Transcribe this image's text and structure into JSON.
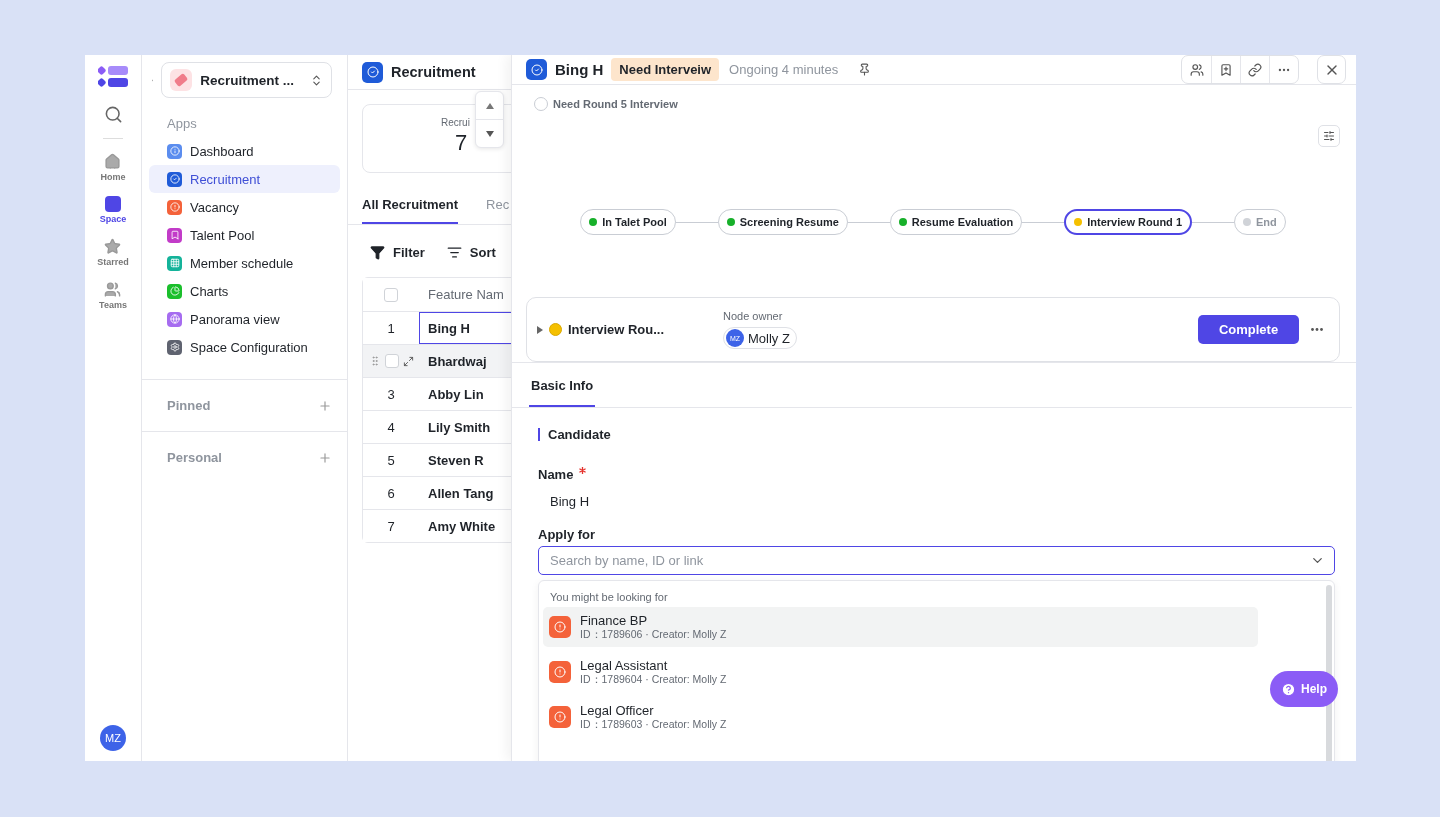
{
  "rail": {
    "items": [
      {
        "label": "Home",
        "selected": false
      },
      {
        "label": "Space",
        "selected": true
      },
      {
        "label": "Starred",
        "selected": false
      },
      {
        "label": "Teams",
        "selected": false
      }
    ],
    "avatar": "MZ"
  },
  "sidebar": {
    "space": "Recruitment ...",
    "section": "Apps",
    "items": [
      {
        "label": "Dashboard",
        "color": "#5b8def",
        "selected": false
      },
      {
        "label": "Recruitment",
        "color": "#1f5bd8",
        "selected": true
      },
      {
        "label": "Vacancy",
        "color": "#f4623a",
        "selected": false
      },
      {
        "label": "Talent Pool",
        "color": "#c23bc8",
        "selected": false
      },
      {
        "label": "Member schedule",
        "color": "#14b39a",
        "selected": false
      },
      {
        "label": "Charts",
        "color": "#1bbf2c",
        "selected": false
      },
      {
        "label": "Panorama view",
        "color": "#a66cf0",
        "selected": false
      },
      {
        "label": "Space Configuration",
        "color": "#5f6370",
        "selected": false
      }
    ],
    "groups": [
      "Pinned",
      "Personal"
    ]
  },
  "list": {
    "title": "Recruitment",
    "card": {
      "label": "Recrui",
      "value": "7"
    },
    "tabs": [
      {
        "label": "All Recruitment",
        "selected": true
      },
      {
        "label": "Rec",
        "selected": false
      }
    ],
    "toolbar": [
      "Filter",
      "Sort"
    ],
    "column": "Feature Nam",
    "all_checked": false,
    "rows": [
      {
        "index": "1",
        "name": "Bing H",
        "selected": true,
        "hovered": false
      },
      {
        "index": "",
        "name": "Bhardwaj",
        "selected": false,
        "hovered": true,
        "checked": false
      },
      {
        "index": "3",
        "name": "Abby Lin",
        "selected": false,
        "hovered": false
      },
      {
        "index": "4",
        "name": "Lily Smith",
        "selected": false,
        "hovered": false
      },
      {
        "index": "5",
        "name": "Steven R",
        "selected": false,
        "hovered": false
      },
      {
        "index": "6",
        "name": "Allen Tang",
        "selected": false,
        "hovered": false
      },
      {
        "index": "7",
        "name": "Amy White",
        "selected": false,
        "hovered": false
      }
    ]
  },
  "detail": {
    "title": "Bing H",
    "badge": "Need Interveiw",
    "status": "Ongoing 4 minutes",
    "task": {
      "label": "Need Round 5 Interview",
      "checked": false
    },
    "stages": [
      {
        "label": "In Talet Pool",
        "color": "#17b02a",
        "selected": false,
        "pending": false
      },
      {
        "label": "Screening Resume",
        "color": "#17b02a",
        "selected": false,
        "pending": false
      },
      {
        "label": "Resume Evaluation",
        "color": "#17b02a",
        "selected": false,
        "pending": false
      },
      {
        "label": "Interview Round 1",
        "color": "#f5c000",
        "selected": true,
        "pending": false
      },
      {
        "label": "End",
        "color": "#d0d3d8",
        "selected": false,
        "pending": true
      }
    ],
    "node": {
      "title": "Interview Rou...",
      "owner_label": "Node owner",
      "owner_initials": "MZ",
      "owner": "Molly Z",
      "action": "Complete"
    },
    "tabs": [
      {
        "label": "Basic Info",
        "selected": true
      }
    ],
    "section": "Candidate",
    "name_label": "Name",
    "name_value": "Bing H",
    "apply_label": "Apply for",
    "apply_placeholder": "Search by name, ID or link",
    "dropdown": {
      "hint": "You might be looking for",
      "options": [
        {
          "name": "Finance BP",
          "meta": "ID：1789606 · Creator: Molly Z",
          "selected": true
        },
        {
          "name": "Legal Assistant",
          "meta": "ID：1789604 · Creator: Molly Z",
          "selected": false
        },
        {
          "name": "Legal Officer",
          "meta": "ID：1789603 · Creator: Molly Z",
          "selected": false
        }
      ]
    },
    "help": "Help"
  }
}
